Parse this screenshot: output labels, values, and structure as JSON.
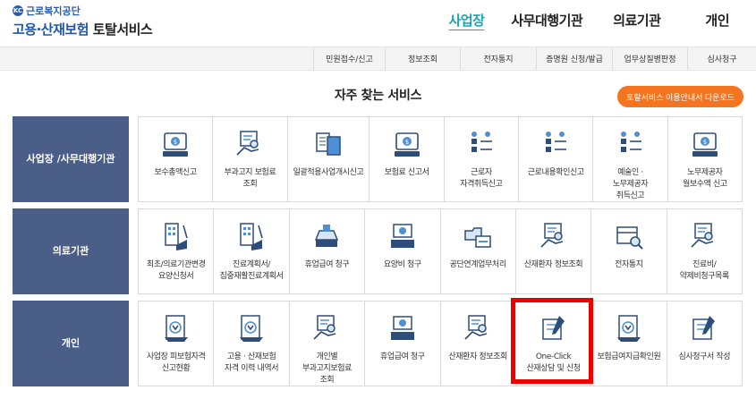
{
  "logo": {
    "mark": "KC",
    "org": "근로복지공단",
    "service_blue": "고용·산재보험",
    "service_dark": " 토탈서비스"
  },
  "gnb": [
    "사업장",
    "사무대행기관",
    "의료기관",
    "개인"
  ],
  "subnav": [
    "민원접수/신고",
    "정보조회",
    "전자통지",
    "증명원 신청/발급",
    "업무상질병판정",
    "심사청구"
  ],
  "section_title": "자주 찾는 서비스",
  "guide_button": "토탈서비스 이용안내서 다운로드",
  "rows": [
    {
      "category": [
        "사업장 /",
        "사무대행기관"
      ],
      "items": [
        {
          "label": "보수총액신고",
          "icon": "money-monitor-icon"
        },
        {
          "label": "부과고지 보험료 조회",
          "icon": "search-document-icon"
        },
        {
          "label": "일괄적용사업개시신고",
          "icon": "document-transfer-icon"
        },
        {
          "label": "보험료 신고서",
          "icon": "money-monitor-icon"
        },
        {
          "label": "근로자 자격취득신고",
          "icon": "people-checklist-icon"
        },
        {
          "label": "근로내용확인신고",
          "icon": "people-checklist-icon"
        },
        {
          "label": "예술인 · 노무제공자 취득신고",
          "icon": "people-checklist-icon"
        },
        {
          "label": "노무제공자 월보수액 신고",
          "icon": "money-monitor-icon"
        }
      ]
    },
    {
      "category": [
        "의료기관"
      ],
      "items": [
        {
          "label": "최초/의료기관변경 요양신청서",
          "icon": "building-sign-icon"
        },
        {
          "label": "진료계획서/집중재활진료계획서",
          "icon": "building-sign-icon"
        },
        {
          "label": "휴업급여 청구",
          "icon": "inbox-tray-icon"
        },
        {
          "label": "요양비 청구",
          "icon": "money-tray-icon"
        },
        {
          "label": "공단연계업무처리",
          "icon": "folder-sync-icon"
        },
        {
          "label": "산재환자 정보조회",
          "icon": "search-document-icon"
        },
        {
          "label": "전자통지",
          "icon": "box-search-icon"
        },
        {
          "label": "진료비/약제비청구목록",
          "icon": "search-document-icon"
        }
      ]
    },
    {
      "category": [
        "개인"
      ],
      "items": [
        {
          "label": "사업장 피보험자격 신고현황",
          "icon": "download-document-icon"
        },
        {
          "label": "고용 · 산재보험 자격 이력 내역서",
          "icon": "download-document-icon"
        },
        {
          "label": "개인별 부과고지보험료 조회",
          "icon": "search-document-icon"
        },
        {
          "label": "휴업급여 청구",
          "icon": "money-tray-icon"
        },
        {
          "label": "산재환자 정보조회",
          "icon": "search-document-icon"
        },
        {
          "label": "One-Click 산재상담 및 신청",
          "icon": "write-document-icon"
        },
        {
          "label": "보험급여지급확인원",
          "icon": "download-document-icon"
        },
        {
          "label": "심사청구서 작성",
          "icon": "write-document-icon"
        }
      ]
    }
  ]
}
